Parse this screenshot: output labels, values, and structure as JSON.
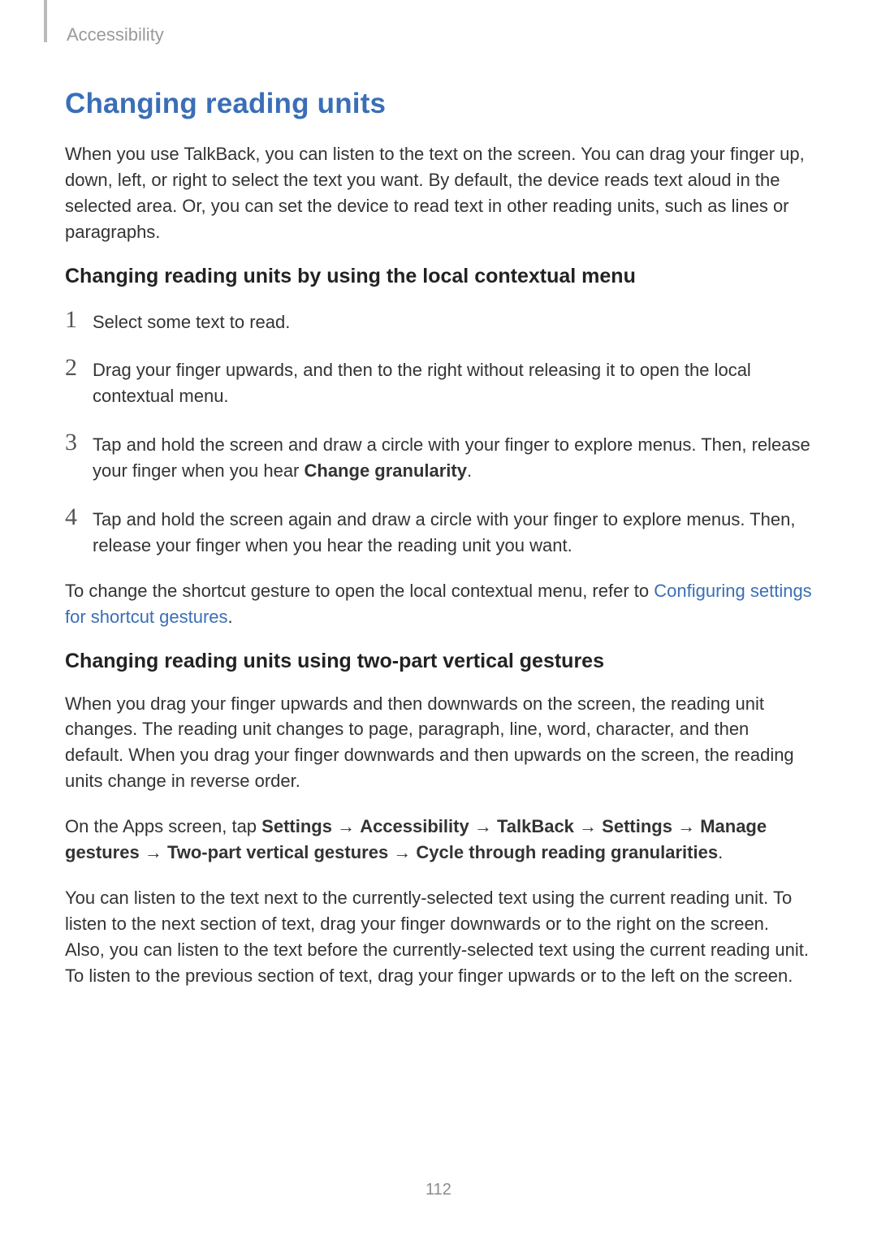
{
  "header": {
    "section": "Accessibility"
  },
  "title": "Changing reading units",
  "intro": "When you use TalkBack, you can listen to the text on the screen. You can drag your finger up, down, left, or right to select the text you want. By default, the device reads text aloud in the selected area. Or, you can set the device to read text in other reading units, such as lines or paragraphs.",
  "section1": {
    "heading": "Changing reading units by using the local contextual menu",
    "steps": {
      "s1": {
        "num": "1",
        "text": "Select some text to read."
      },
      "s2": {
        "num": "2",
        "text": "Drag your finger upwards, and then to the right without releasing it to open the local contextual menu."
      },
      "s3": {
        "num": "3",
        "before": "Tap and hold the screen and draw a circle with your finger to explore menus. Then, release your finger when you hear ",
        "bold": "Change granularity",
        "after": "."
      },
      "s4": {
        "num": "4",
        "text": "Tap and hold the screen again and draw a circle with your finger to explore menus. Then, release your finger when you hear the reading unit you want."
      }
    },
    "footnote": {
      "before": "To change the shortcut gesture to open the local contextual menu, refer to ",
      "link": "Configuring settings for shortcut gestures",
      "after": "."
    }
  },
  "section2": {
    "heading": "Changing reading units using two-part vertical gestures",
    "p1": "When you drag your finger upwards and then downwards on the screen, the reading unit changes. The reading unit changes to page, paragraph, line, word, character, and then default. When you drag your finger downwards and then upwards on the screen, the reading units change in reverse order.",
    "path": {
      "lead": "On the Apps screen, tap ",
      "b1": "Settings",
      "a": " → ",
      "b2": "Accessibility",
      "b3": "TalkBack",
      "b4": "Settings",
      "b5": "Manage gestures",
      "b6": "Two-part vertical gestures",
      "b7": "Cycle through reading granularities",
      "end": "."
    },
    "p3": "You can listen to the text next to the currently-selected text using the current reading unit. To listen to the next section of text, drag your finger downwards or to the right on the screen. Also, you can listen to the text before the currently-selected text using the current reading unit. To listen to the previous section of text, drag your finger upwards or to the left on the screen."
  },
  "page_number": "112"
}
